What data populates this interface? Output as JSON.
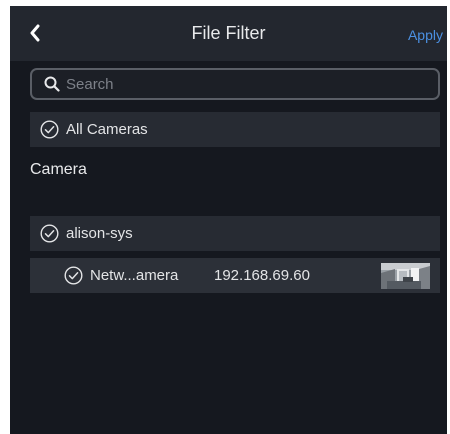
{
  "header": {
    "title": "File Filter",
    "apply_label": "Apply",
    "back_icon": "chevron-left-icon"
  },
  "search": {
    "placeholder": "Search",
    "value": ""
  },
  "all_cameras": {
    "label": "All Cameras",
    "checked": true
  },
  "section": {
    "title": "Camera"
  },
  "groups": [
    {
      "name": "alison-sys",
      "checked": true,
      "cameras": [
        {
          "name": "Netw...amera",
          "ip": "192.168.69.60",
          "checked": true,
          "thumbnail": "camera-thumbnail"
        }
      ]
    }
  ],
  "colors": {
    "background": "#15181f",
    "header": "#23272f",
    "row": "#272b33",
    "accent": "#4b90e2",
    "text": "#e3e4e6"
  }
}
